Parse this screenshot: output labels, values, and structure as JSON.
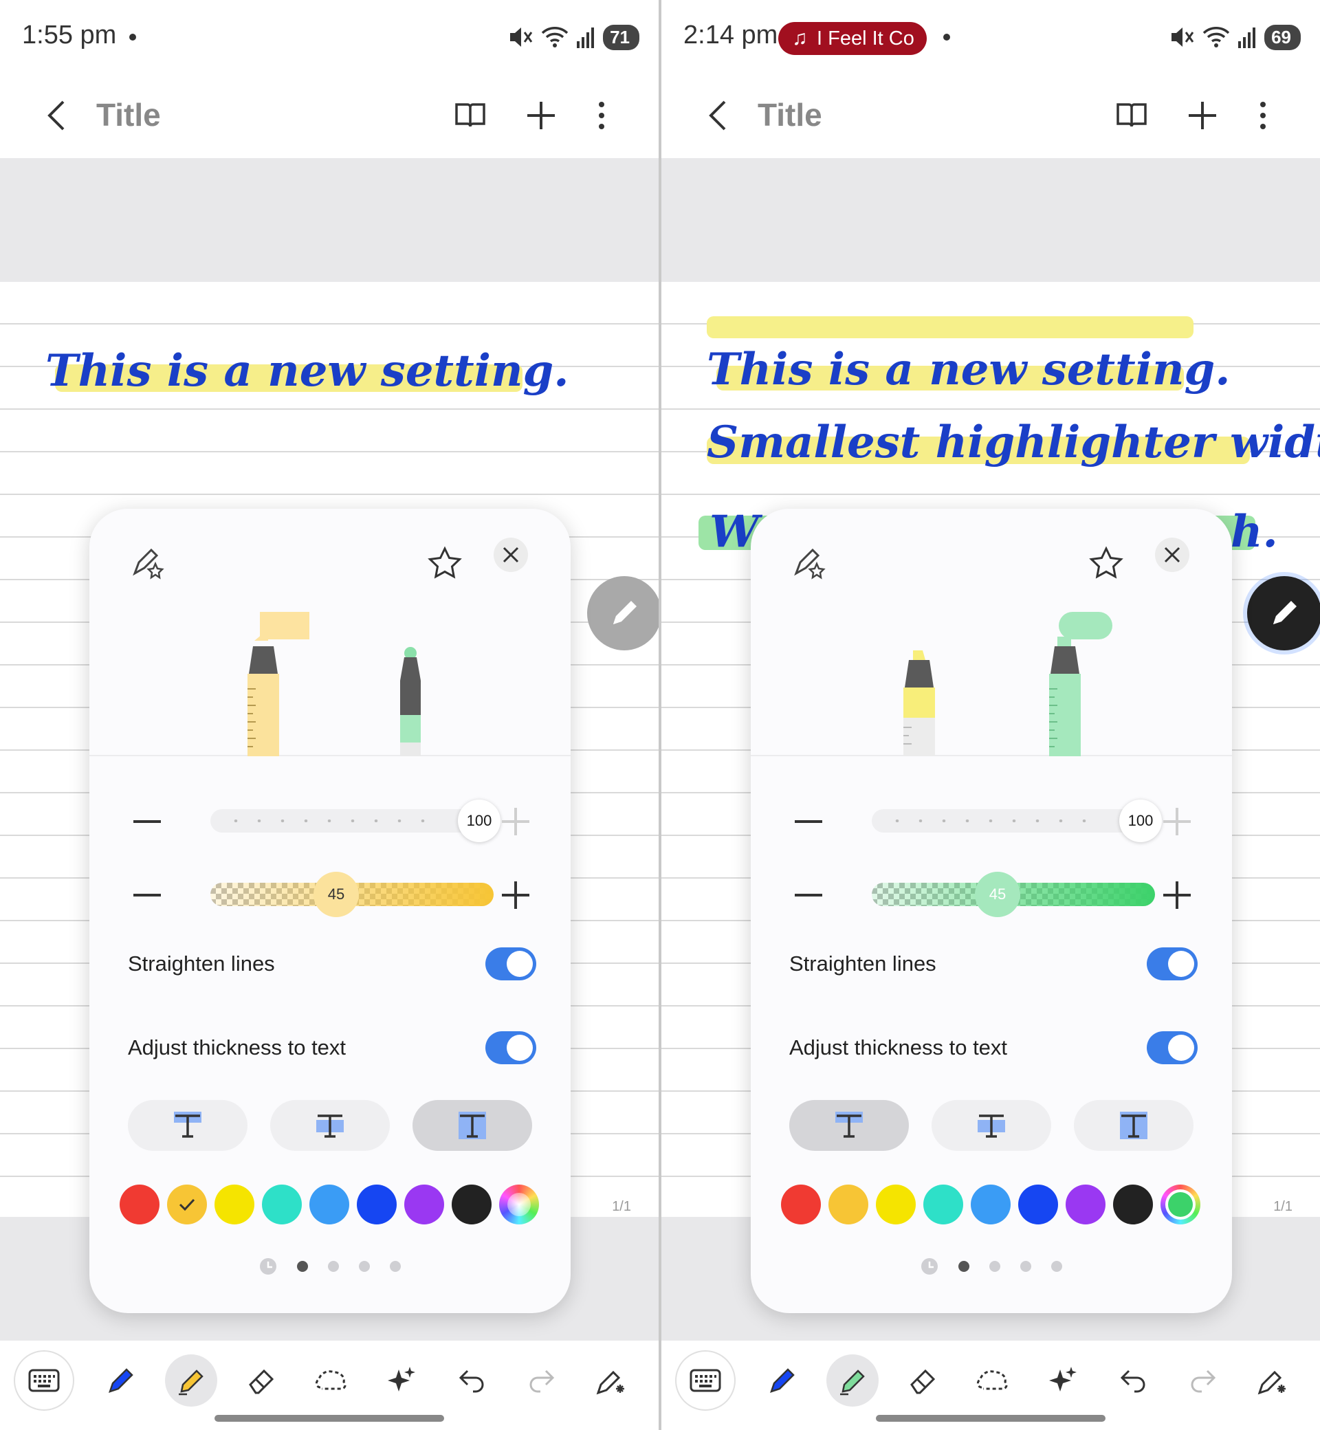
{
  "left": {
    "status": {
      "time": "1:55 pm",
      "battery": "71"
    },
    "appbar": {
      "title": "Title"
    },
    "note_lines": [
      "This is a new setting."
    ],
    "pen_settings": {
      "size_value": "100",
      "opacity_value": "45",
      "opacity_percent": 45,
      "straighten_lines_label": "Straighten lines",
      "straighten_lines_on": true,
      "adjust_thickness_label": "Adjust thickness to text",
      "adjust_thickness_on": true,
      "selected_text_mode": 3,
      "selected_color": "#f7c535",
      "colors": [
        "#f03a32",
        "#f7c535",
        "#f5e400",
        "#2ee0c8",
        "#3a9cf5",
        "#1646f2",
        "#9a38f2",
        "#222222",
        "spectrum"
      ]
    },
    "page_number": "1/1"
  },
  "right": {
    "status": {
      "time": "2:14 pm",
      "music": "I Feel It Co",
      "battery": "69"
    },
    "appbar": {
      "title": "Title"
    },
    "note_lines": [
      "This is a new setting.",
      "Smallest highlighter width.",
      "W",
      "h."
    ],
    "pen_settings": {
      "size_value": "100",
      "opacity_value": "45",
      "opacity_percent": 45,
      "straighten_lines_label": "Straighten lines",
      "straighten_lines_on": true,
      "adjust_thickness_label": "Adjust thickness to text",
      "adjust_thickness_on": true,
      "selected_text_mode": 1,
      "selected_color": "#3cd26a",
      "colors": [
        "#f03a32",
        "#f7c535",
        "#f5e400",
        "#2ee0c8",
        "#3a9cf5",
        "#1646f2",
        "#9a38f2",
        "#222222",
        "spectrum"
      ]
    },
    "page_number": "1/1"
  },
  "toolbar_icons": [
    "keyboard-icon",
    "pen-icon",
    "highlighter-icon",
    "eraser-icon",
    "lasso-icon",
    "ai-sparkle-icon",
    "undo-icon",
    "redo-icon",
    "pen-settings-icon"
  ]
}
